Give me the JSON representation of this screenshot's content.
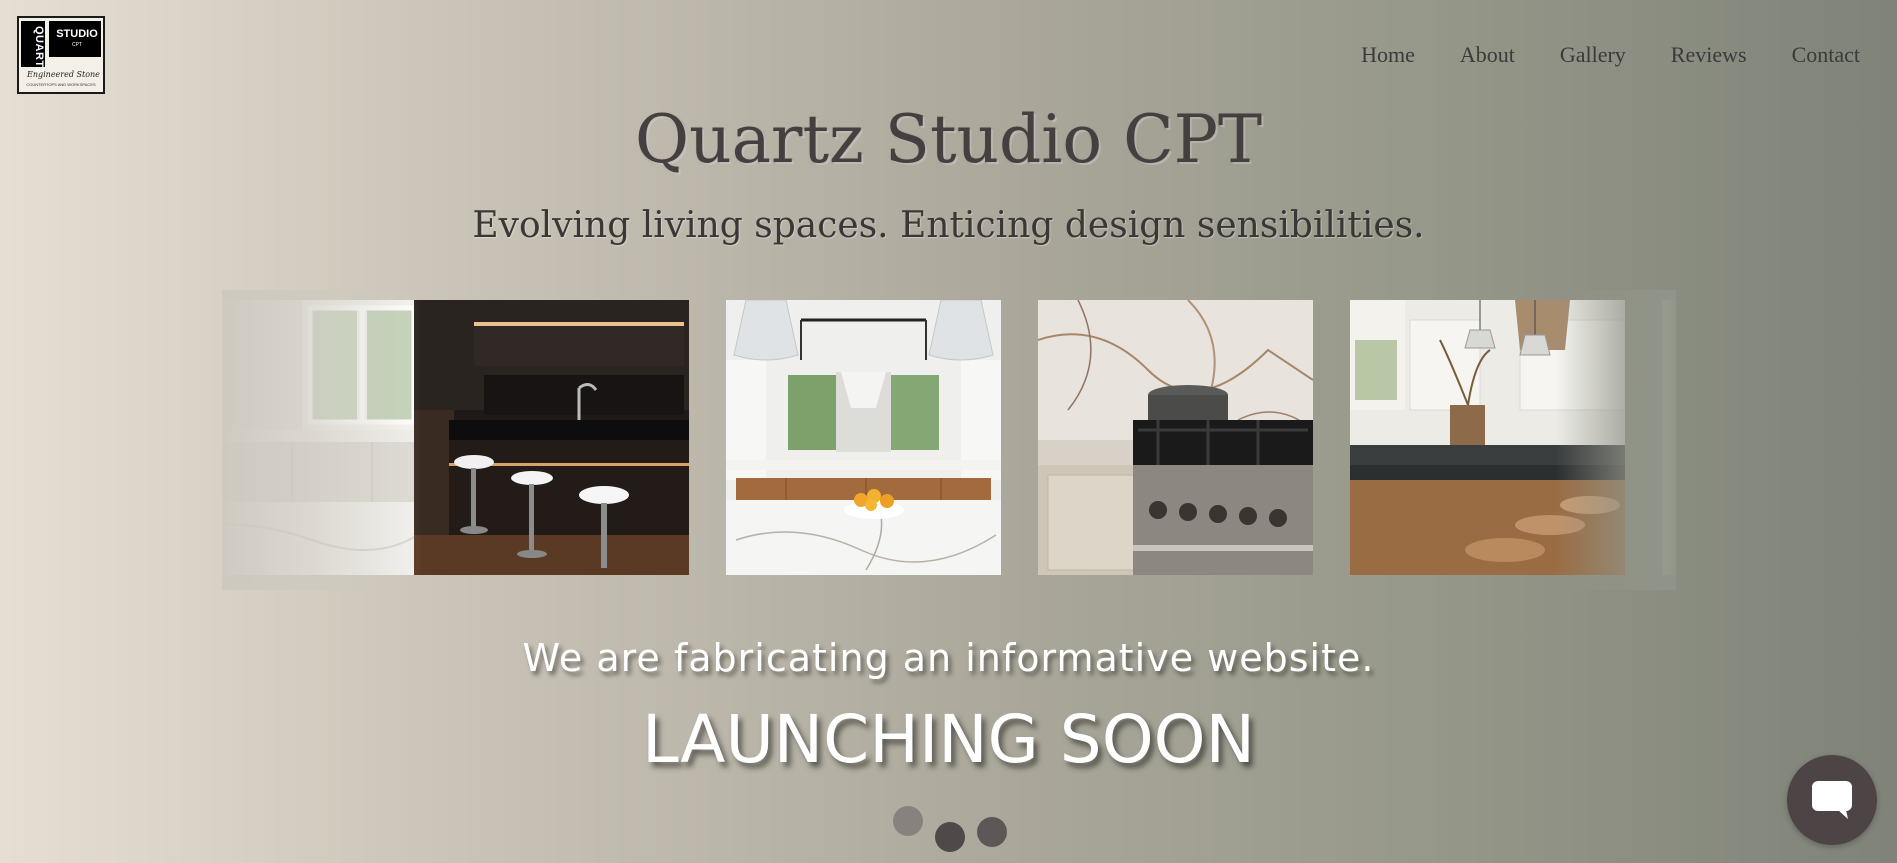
{
  "brand": {
    "logo_line1": "QUARTZ",
    "logo_line2": "STUDIO",
    "logo_line3": "CPT",
    "logo_script": "Engineered Stone",
    "logo_sub": "COUNTERTOPS AND WORKSPACES"
  },
  "nav": {
    "items": [
      {
        "label": "Home"
      },
      {
        "label": "About"
      },
      {
        "label": "Gallery"
      },
      {
        "label": "Reviews"
      },
      {
        "label": "Contact"
      }
    ]
  },
  "hero": {
    "title": "Quartz Studio CPT",
    "tagline": "Evolving living spaces. Enticing design sensibilities."
  },
  "carousel": {
    "slides": [
      {
        "subject": "white kitchen with window"
      },
      {
        "subject": "dark kitchen island with white stools"
      },
      {
        "subject": "white kitchen with pendant lights and lemon bowl"
      },
      {
        "subject": "marble backsplash with gas range"
      },
      {
        "subject": "kitchen island with dark countertop and wooden stools"
      }
    ],
    "dots": [
      {
        "state": "inactive"
      },
      {
        "state": "active"
      },
      {
        "state": "inactive"
      }
    ]
  },
  "announcement": {
    "message": "We are fabricating an informative website.",
    "headline": "LAUNCHING SOON"
  },
  "chat": {
    "icon": "chat-bubble-icon"
  },
  "colors": {
    "title": "#453f3f",
    "nav_text": "#3a3a3a",
    "chat_button": "#4d4545",
    "announce_text": "#ffffff"
  }
}
